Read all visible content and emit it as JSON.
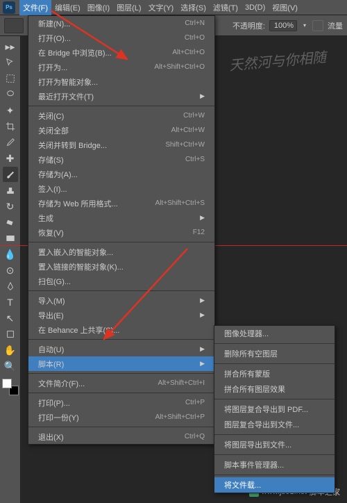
{
  "menubar": {
    "logo": "Ps",
    "items": [
      "文件(F)",
      "编辑(E)",
      "图像(I)",
      "图层(L)",
      "文字(Y)",
      "选择(S)",
      "滤镜(T)",
      "3D(D)",
      "视图(V)"
    ]
  },
  "optbar": {
    "brush_size": "•",
    "opacity_label": "不透明度:",
    "opacity_value": "100%",
    "flow_label": "流量"
  },
  "watermark": "天然河与你相随",
  "file_menu": [
    {
      "label": "新建(N)...",
      "shortcut": "Ctrl+N"
    },
    {
      "label": "打开(O)...",
      "shortcut": "Ctrl+O"
    },
    {
      "label": "在 Bridge 中浏览(B)...",
      "shortcut": "Alt+Ctrl+O"
    },
    {
      "label": "打开为...",
      "shortcut": "Alt+Shift+Ctrl+O"
    },
    {
      "label": "打开为智能对象..."
    },
    {
      "label": "最近打开文件(T)",
      "submenu": true
    },
    {
      "sep": true
    },
    {
      "label": "关闭(C)",
      "shortcut": "Ctrl+W"
    },
    {
      "label": "关闭全部",
      "shortcut": "Alt+Ctrl+W"
    },
    {
      "label": "关闭并转到 Bridge...",
      "shortcut": "Shift+Ctrl+W"
    },
    {
      "label": "存储(S)",
      "shortcut": "Ctrl+S"
    },
    {
      "label": "存储为(A)...",
      "shortcut": ""
    },
    {
      "label": "签入(I)..."
    },
    {
      "label": "存储为 Web 所用格式...",
      "shortcut": "Alt+Shift+Ctrl+S"
    },
    {
      "label": "生成",
      "submenu": true
    },
    {
      "label": "恢复(V)",
      "shortcut": "F12"
    },
    {
      "sep": true
    },
    {
      "label": "置入嵌入的智能对象..."
    },
    {
      "label": "置入链接的智能对象(K)..."
    },
    {
      "label": "扫包(G)..."
    },
    {
      "sep": true
    },
    {
      "label": "导入(M)",
      "submenu": true
    },
    {
      "label": "导出(E)",
      "submenu": true
    },
    {
      "label": "在 Behance 上共享(S)..."
    },
    {
      "sep": true
    },
    {
      "label": "自动(U)",
      "submenu": true
    },
    {
      "label": "脚本(R)",
      "submenu": true,
      "highlight": true
    },
    {
      "sep": true
    },
    {
      "label": "文件简介(F)...",
      "shortcut": "Alt+Shift+Ctrl+I"
    },
    {
      "sep": true
    },
    {
      "label": "打印(P)...",
      "shortcut": "Ctrl+P"
    },
    {
      "label": "打印一份(Y)",
      "shortcut": "Alt+Shift+Ctrl+P"
    },
    {
      "sep": true
    },
    {
      "label": "退出(X)",
      "shortcut": "Ctrl+Q"
    }
  ],
  "script_submenu": [
    {
      "label": "图像处理器..."
    },
    {
      "sep": true
    },
    {
      "label": "删除所有空图层"
    },
    {
      "sep": true
    },
    {
      "label": "拼合所有蒙版"
    },
    {
      "label": "拼合所有图层效果"
    },
    {
      "sep": true
    },
    {
      "label": "将图层复合导出到 PDF..."
    },
    {
      "label": "图层复合导出到文件..."
    },
    {
      "sep": true
    },
    {
      "label": "将图层导出到文件..."
    },
    {
      "sep": true
    },
    {
      "label": "脚本事件管理器..."
    },
    {
      "sep": true
    },
    {
      "label": "将文件载...",
      "highlight": true
    }
  ],
  "footer": {
    "site": "www.jb51.net",
    "tag": "脚本之家"
  }
}
